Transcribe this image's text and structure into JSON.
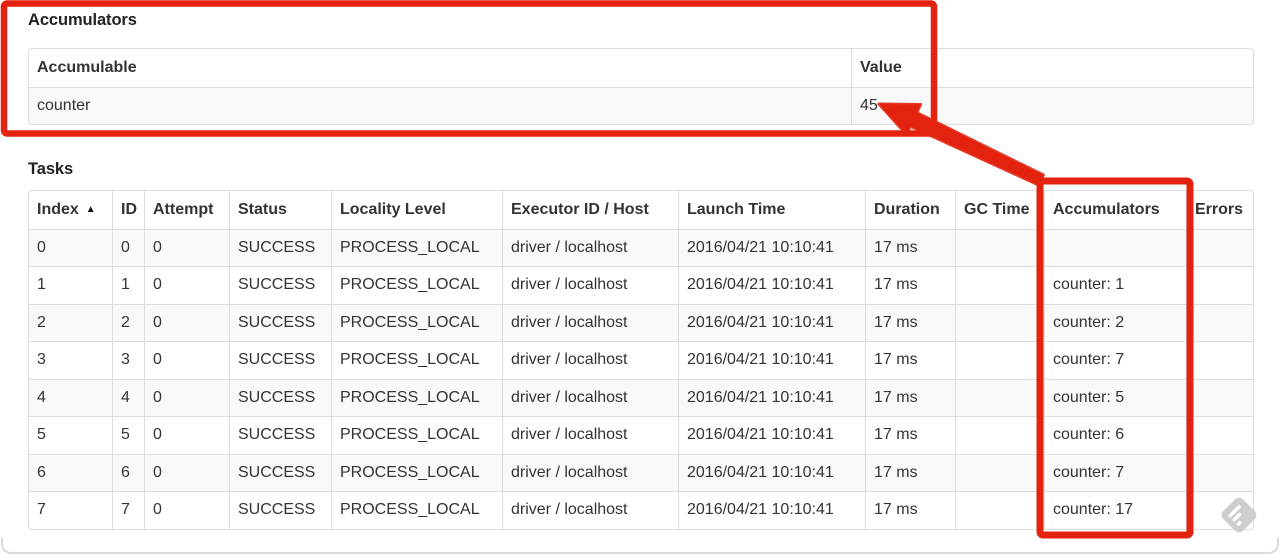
{
  "accumulators": {
    "heading": "Accumulators",
    "columns": [
      "Accumulable",
      "Value"
    ],
    "rows": [
      {
        "accumulable": "counter",
        "value": "45"
      }
    ]
  },
  "tasks": {
    "heading": "Tasks",
    "columns": [
      "Index",
      "ID",
      "Attempt",
      "Status",
      "Locality Level",
      "Executor ID / Host",
      "Launch Time",
      "Duration",
      "GC Time",
      "Accumulators",
      "Errors"
    ],
    "sort": {
      "column": "Index",
      "direction": "ascending",
      "icon": "▲"
    },
    "row_keys": [
      "index",
      "id",
      "attempt",
      "status",
      "locality_level",
      "executor_id_host",
      "launch_time",
      "duration",
      "gc_time",
      "accumulators",
      "errors"
    ],
    "rows": [
      {
        "index": "0",
        "id": "0",
        "attempt": "0",
        "status": "SUCCESS",
        "locality_level": "PROCESS_LOCAL",
        "executor_id_host": "driver / localhost",
        "launch_time": "2016/04/21 10:10:41",
        "duration": "17 ms",
        "gc_time": "",
        "accumulators": "",
        "errors": ""
      },
      {
        "index": "1",
        "id": "1",
        "attempt": "0",
        "status": "SUCCESS",
        "locality_level": "PROCESS_LOCAL",
        "executor_id_host": "driver / localhost",
        "launch_time": "2016/04/21 10:10:41",
        "duration": "17 ms",
        "gc_time": "",
        "accumulators": "counter: 1",
        "errors": ""
      },
      {
        "index": "2",
        "id": "2",
        "attempt": "0",
        "status": "SUCCESS",
        "locality_level": "PROCESS_LOCAL",
        "executor_id_host": "driver / localhost",
        "launch_time": "2016/04/21 10:10:41",
        "duration": "17 ms",
        "gc_time": "",
        "accumulators": "counter: 2",
        "errors": ""
      },
      {
        "index": "3",
        "id": "3",
        "attempt": "0",
        "status": "SUCCESS",
        "locality_level": "PROCESS_LOCAL",
        "executor_id_host": "driver / localhost",
        "launch_time": "2016/04/21 10:10:41",
        "duration": "17 ms",
        "gc_time": "",
        "accumulators": "counter: 7",
        "errors": ""
      },
      {
        "index": "4",
        "id": "4",
        "attempt": "0",
        "status": "SUCCESS",
        "locality_level": "PROCESS_LOCAL",
        "executor_id_host": "driver / localhost",
        "launch_time": "2016/04/21 10:10:41",
        "duration": "17 ms",
        "gc_time": "",
        "accumulators": "counter: 5",
        "errors": ""
      },
      {
        "index": "5",
        "id": "5",
        "attempt": "0",
        "status": "SUCCESS",
        "locality_level": "PROCESS_LOCAL",
        "executor_id_host": "driver / localhost",
        "launch_time": "2016/04/21 10:10:41",
        "duration": "17 ms",
        "gc_time": "",
        "accumulators": "counter: 6",
        "errors": ""
      },
      {
        "index": "6",
        "id": "6",
        "attempt": "0",
        "status": "SUCCESS",
        "locality_level": "PROCESS_LOCAL",
        "executor_id_host": "driver / localhost",
        "launch_time": "2016/04/21 10:10:41",
        "duration": "17 ms",
        "gc_time": "",
        "accumulators": "counter: 7",
        "errors": ""
      },
      {
        "index": "7",
        "id": "7",
        "attempt": "0",
        "status": "SUCCESS",
        "locality_level": "PROCESS_LOCAL",
        "executor_id_host": "driver / localhost",
        "launch_time": "2016/04/21 10:10:41",
        "duration": "17 ms",
        "gc_time": "",
        "accumulators": "counter: 17",
        "errors": ""
      }
    ]
  },
  "annotations": {
    "color": "#e3230f",
    "highlighted_value": "45",
    "highlighted_column": "Accumulators"
  },
  "colors": {
    "annotation_red": "#e3230f",
    "table_border": "#dddddd",
    "row_stripe": "#f9f9f9",
    "text": "#333333",
    "watermark_gray": "#c8c8c8",
    "frame_edge": "#dadada"
  }
}
